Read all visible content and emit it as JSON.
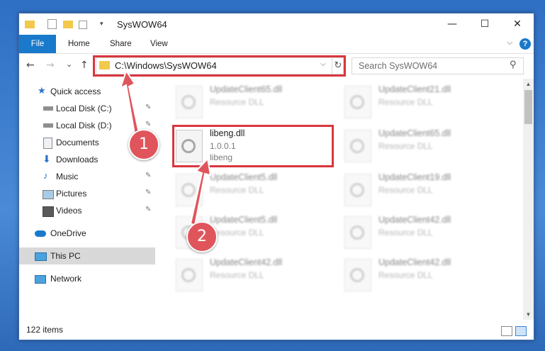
{
  "window": {
    "title": "SysWOW64"
  },
  "titlebar": {
    "minimize": "—",
    "maximize": "☐",
    "close": "✕"
  },
  "ribbon": {
    "tabs": [
      "File",
      "Home",
      "Share",
      "View"
    ],
    "collapse": "⌵",
    "help": "?"
  },
  "nav": {
    "back": "←",
    "forward": "→",
    "recent": "⌄",
    "up": "↑",
    "address": "C:\\Windows\\SysWOW64",
    "address_dropdown": "⌵",
    "refresh": "↻",
    "search_placeholder": "Search SysWOW64",
    "search_icon_glyph": "⚲"
  },
  "sidebar": {
    "items": [
      {
        "label": "Quick access",
        "icon": "star-icon"
      },
      {
        "label": "Local Disk (C:)",
        "icon": "drive-icon",
        "pinned": true
      },
      {
        "label": "Local Disk (D:)",
        "icon": "drive-icon",
        "pinned": true
      },
      {
        "label": "Documents",
        "icon": "documents-icon",
        "pinned": true
      },
      {
        "label": "Downloads",
        "icon": "downloads-icon",
        "pinned": true
      },
      {
        "label": "Music",
        "icon": "music-icon",
        "pinned": true
      },
      {
        "label": "Pictures",
        "icon": "pictures-icon",
        "pinned": true
      },
      {
        "label": "Videos",
        "icon": "videos-icon",
        "pinned": true
      },
      {
        "label": "OneDrive",
        "icon": "cloud-icon"
      },
      {
        "label": "This PC",
        "icon": "computer-icon",
        "selected": true
      },
      {
        "label": "Network",
        "icon": "network-icon"
      }
    ],
    "pin_glyph": "✎"
  },
  "files": {
    "highlighted": {
      "name": "libeng.dll",
      "version": "1.0.0.1",
      "description": "libeng"
    },
    "blurred": [
      {
        "name": "UpdateClient65.dll",
        "type": "Resource DLL"
      },
      {
        "name": "UpdateClient21.dll",
        "type": "Resource DLL"
      },
      {
        "name": "UpdateClient65.dll",
        "type": "Resource DLL"
      },
      {
        "name": "UpdateClient5.dll",
        "type": "Resource DLL"
      },
      {
        "name": "UpdateClient19.dll",
        "type": "Resource DLL"
      },
      {
        "name": "UpdateClient5.dll",
        "type": "Resource DLL"
      },
      {
        "name": "UpdateClient42.dll",
        "type": "Resource DLL"
      },
      {
        "name": "UpdateClient42.dll",
        "type": "Resource DLL"
      },
      {
        "name": "UpdateClient42.dll",
        "type": "Resource DLL"
      }
    ]
  },
  "status": {
    "item_count": "122 items"
  },
  "callouts": {
    "step1": "1",
    "step2": "2"
  },
  "colors": {
    "accent": "#1979ca",
    "highlight": "#d9363e",
    "callout": "#e0555c"
  }
}
